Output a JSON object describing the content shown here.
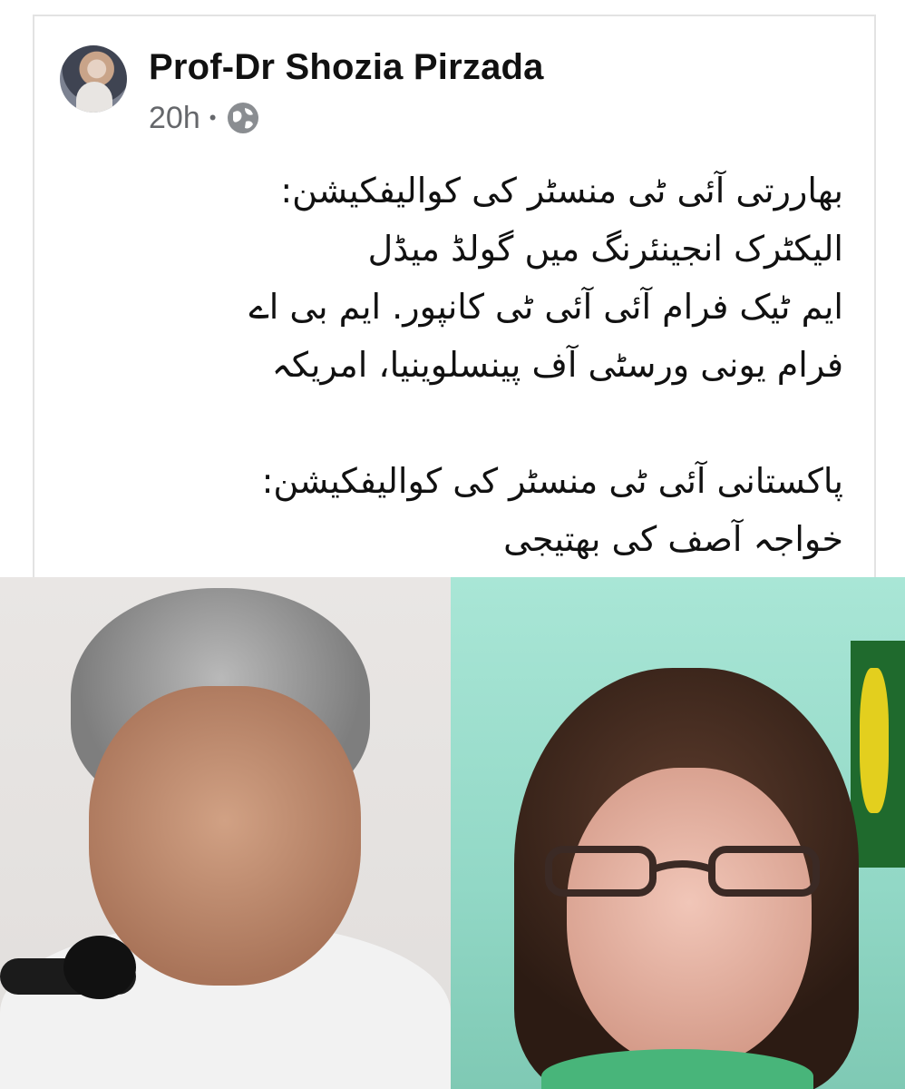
{
  "post": {
    "author_name": "Prof-Dr Shozia Pirzada",
    "time_label": "20h",
    "separator": "•",
    "privacy_icon": "globe-icon",
    "text_lines_group1": [
      "بھاررتی آئی ٹی منسٹر کی کوالیفکیشن:",
      "الیکٹرک انجینئرنگ میں گولڈ میڈل",
      "ایم ٹیک فرام آئی آئی ٹی کانپور. ایم بی اے",
      "فرام یونی ورسٹی آف پینسلوینیا، امریکہ"
    ],
    "text_lines_group2": [
      "پاکستانی آئی ٹی منسٹر کی کوالیفکیشن:",
      "خواجہ آصف کی بھتیجی"
    ]
  },
  "colors": {
    "meta_text": "#65676b",
    "card_border": "#e3e3e3"
  }
}
